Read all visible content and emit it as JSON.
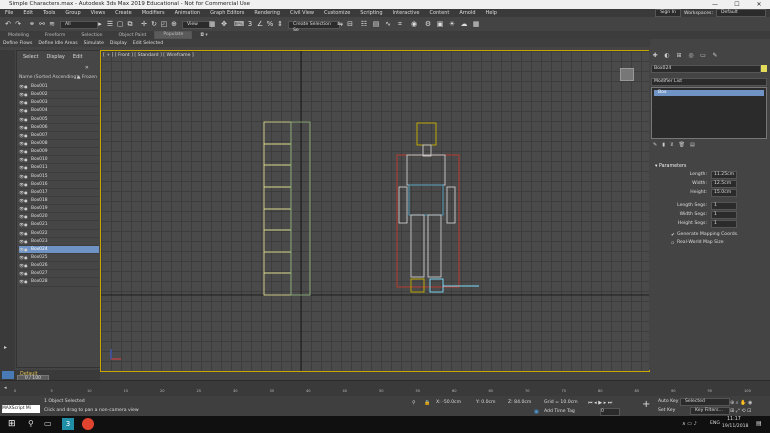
{
  "window": {
    "title": "Simple Characters.max - Autodesk 3ds Max 2019 Educational - Not for Commercial Use",
    "min": "—",
    "max": "☐",
    "close": "✕"
  },
  "menu": [
    "File",
    "Edit",
    "Tools",
    "Group",
    "Views",
    "Create",
    "Modifiers",
    "Animation",
    "Graph Editors",
    "Rendering",
    "Civil View",
    "Customize",
    "Scripting",
    "Interactive",
    "Content",
    "Arnold",
    "Help"
  ],
  "signin": "Sign In",
  "workspace_label": "Workspaces:",
  "workspace_value": "Default",
  "toolbar": {
    "selection_filter": "All",
    "coord_system": "View",
    "named_set": "Create Selection Se",
    "populate": "Populate"
  },
  "ribbon_tabs": [
    "Modeling",
    "Freeform",
    "Selection",
    "Object Paint"
  ],
  "subtabs": [
    "Define Flows",
    "Define Idle Areas",
    "Simulate",
    "Display",
    "Edit Selected"
  ],
  "scene_explorer": {
    "tabs": [
      "Select",
      "Display",
      "Edit"
    ],
    "close": "✕",
    "col_name": "Name (Sorted Ascending)",
    "col_frozen": "▲ Frozen",
    "items": [
      "Box001",
      "Box002",
      "Box003",
      "Box004",
      "Box005",
      "Box006",
      "Box007",
      "Box008",
      "Box009",
      "Box010",
      "Box011",
      "Box015",
      "Box016",
      "Box017",
      "Box018",
      "Box019",
      "Box020",
      "Box021",
      "Box022",
      "Box023",
      "Box024",
      "Box025",
      "Box026",
      "Box027",
      "Box028"
    ],
    "selected_index": 20
  },
  "viewport": {
    "label": "[ + ] [ Front ] [ Standard ] [ Wireframe ]"
  },
  "command_panel": {
    "object_name": "Box024",
    "object_color": "#e3dc5a",
    "modifier_list": "Modifier List",
    "stack_item": "Box",
    "rollout_title": "Parameters",
    "params": [
      {
        "label": "Length:",
        "value": "11.25cm"
      },
      {
        "label": "Width:",
        "value": "12.5cm"
      },
      {
        "label": "Height:",
        "value": "15.0cm"
      }
    ],
    "segs": [
      {
        "label": "Length Segs:",
        "value": "1"
      },
      {
        "label": "Width Segs:",
        "value": "1"
      },
      {
        "label": "Height Segs:",
        "value": "1"
      }
    ],
    "gen_mapping": "Generate Mapping Coords.",
    "real_world": "Real-World Map Size"
  },
  "layer": {
    "name": "Default"
  },
  "timeline": {
    "frame": "0 / 100",
    "ticks": [
      "0",
      "5",
      "10",
      "15",
      "20",
      "25",
      "30",
      "35",
      "40",
      "45",
      "50",
      "55",
      "60",
      "65",
      "70",
      "75",
      "80",
      "85",
      "90",
      "95",
      "100"
    ]
  },
  "status": {
    "maxscript": "MAXScript Mi",
    "selected": "1 Object Selected",
    "prompt": "Click and drag to pan a non-camera view",
    "x": "X: -50.0cm",
    "y": "Y: 0.0cm",
    "z": "Z: 84.0cm",
    "grid": "Grid = 10.0cm",
    "add_time_tag": "Add Time Tag",
    "frame_field": "0",
    "auto_key": "Auto Key",
    "set_key": "Set Key",
    "selected_dd": "Selected",
    "key_filters": "Key Filters..."
  },
  "taskbar": {
    "time": "11:17",
    "date": "19/11/2018",
    "lang": "ENG"
  }
}
